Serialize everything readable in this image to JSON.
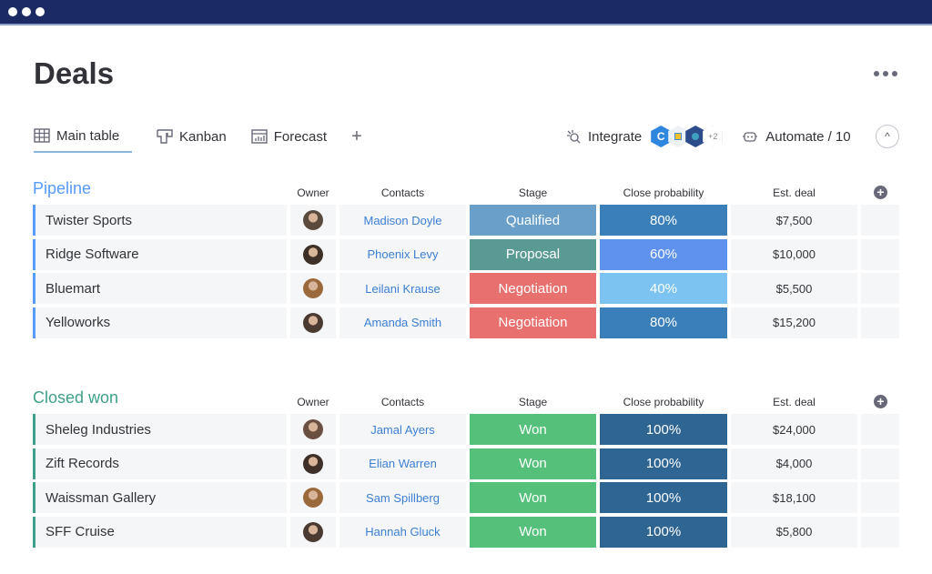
{
  "window": {
    "dots": 3
  },
  "page": {
    "title": "Deals"
  },
  "tabs": [
    {
      "label": "Main table",
      "icon": "table-icon",
      "active": true
    },
    {
      "label": "Kanban",
      "icon": "kanban-icon"
    },
    {
      "label": "Forecast",
      "icon": "chart-icon"
    }
  ],
  "add_tab": "+",
  "toolbar": {
    "integrate_label": "Integrate",
    "integrations_more": "+2",
    "automate_label": "Automate / 10"
  },
  "columns": {
    "owner": "Owner",
    "contacts": "Contacts",
    "stage": "Stage",
    "probability": "Close probability",
    "deal": "Est. deal"
  },
  "colors": {
    "pipeline": "#579bfc",
    "closed": "#3f9f8a",
    "qualified": "#6a9fc9",
    "proposal": "#5a9a94",
    "negotiation": "#e8706e",
    "won": "#55c07a",
    "p80": "#3b7fba",
    "p60": "#5f92ee",
    "p40": "#7cc3f2",
    "p100": "#2e6593"
  },
  "groups": [
    {
      "name": "Pipeline",
      "key": "pipeline",
      "rows": [
        {
          "name": "Twister Sports",
          "contact": "Madison Doyle",
          "stage": "Qualified",
          "stage_color": "#6a9fc9",
          "probability": "80%",
          "prob_color": "#3b7fba",
          "deal": "$7,500",
          "avatar": "#5a4a3e"
        },
        {
          "name": "Ridge Software",
          "contact": "Phoenix Levy",
          "stage": "Proposal",
          "stage_color": "#5a9a94",
          "probability": "60%",
          "prob_color": "#5f92ee",
          "deal": "$10,000",
          "avatar": "#3e2f28"
        },
        {
          "name": "Bluemart",
          "contact": "Leilani Krause",
          "stage": "Negotiation",
          "stage_color": "#e8706e",
          "probability": "40%",
          "prob_color": "#7cc3f2",
          "deal": "$5,500",
          "avatar": "#9a6a3c"
        },
        {
          "name": "Yelloworks",
          "contact": "Amanda Smith",
          "stage": "Negotiation",
          "stage_color": "#e8706e",
          "probability": "80%",
          "prob_color": "#3b7fba",
          "deal": "$15,200",
          "avatar": "#4a3a32"
        }
      ]
    },
    {
      "name": "Closed won",
      "key": "closed",
      "rows": [
        {
          "name": "Sheleg Industries",
          "contact": "Jamal Ayers",
          "stage": "Won",
          "stage_color": "#55c07a",
          "probability": "100%",
          "prob_color": "#2e6593",
          "deal": "$24,000",
          "avatar": "#6a5040"
        },
        {
          "name": "Zift Records",
          "contact": "Elian Warren",
          "stage": "Won",
          "stage_color": "#55c07a",
          "probability": "100%",
          "prob_color": "#2e6593",
          "deal": "$4,000",
          "avatar": "#3e2f28"
        },
        {
          "name": "Waissman Gallery",
          "contact": "Sam Spillberg",
          "stage": "Won",
          "stage_color": "#55c07a",
          "probability": "100%",
          "prob_color": "#2e6593",
          "deal": "$18,100",
          "avatar": "#9a6a3c"
        },
        {
          "name": "SFF Cruise",
          "contact": "Hannah Gluck",
          "stage": "Won",
          "stage_color": "#55c07a",
          "probability": "100%",
          "prob_color": "#2e6593",
          "deal": "$5,800",
          "avatar": "#4a3a32"
        }
      ]
    }
  ]
}
